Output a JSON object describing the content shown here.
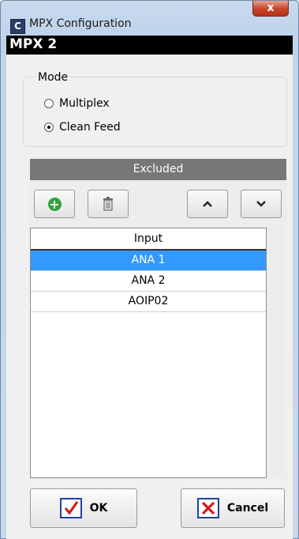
{
  "window": {
    "title": "MPX Configuration",
    "app_icon_letter": "C",
    "close_glyph": "x"
  },
  "header": {
    "title": "MPX 2"
  },
  "mode": {
    "legend": "Mode",
    "options": [
      {
        "label": "Multiplex",
        "checked": false
      },
      {
        "label": "Clean Feed",
        "checked": true
      }
    ]
  },
  "excluded": {
    "title": "Excluded",
    "toolbar": {
      "add_icon": "plus-circle-icon",
      "delete_icon": "trash-icon",
      "up_icon": "chevron-up-icon",
      "down_icon": "chevron-down-icon"
    },
    "list": {
      "column_header": "Input",
      "rows": [
        {
          "label": "ANA 1",
          "selected": true
        },
        {
          "label": "ANA 2",
          "selected": false
        },
        {
          "label": "AOIP02",
          "selected": false
        }
      ]
    }
  },
  "buttons": {
    "ok_label": "OK",
    "cancel_label": "Cancel"
  },
  "colors": {
    "selection": "#3399ff",
    "header_bar": "#000000",
    "panel_header": "#777777",
    "add_icon": "#2fa23a",
    "close_button": "#c9472b"
  }
}
